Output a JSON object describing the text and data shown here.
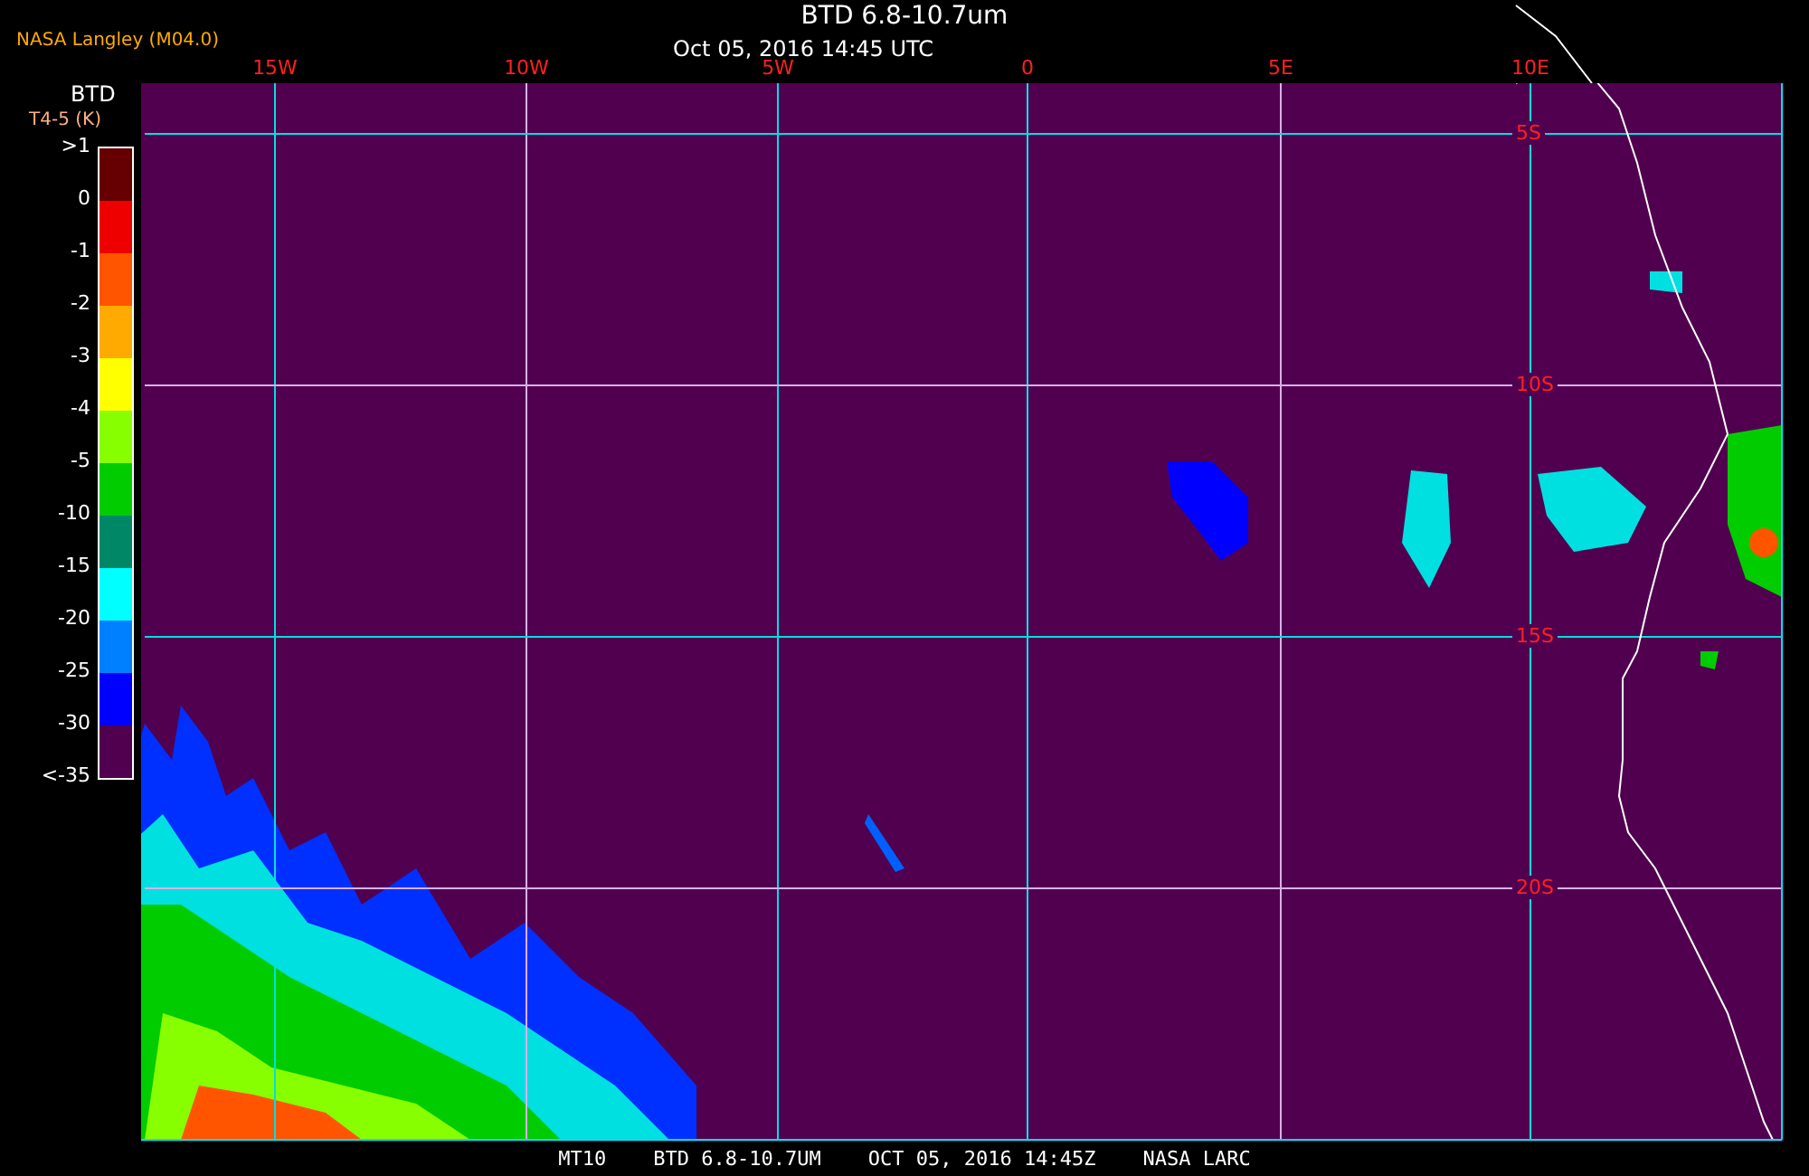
{
  "producer": "NASA Langley (M04.0)",
  "title": "BTD 6.8-10.7um",
  "timestamp": "Oct 05, 2016 14:45 UTC",
  "legend": {
    "title": "BTD",
    "units": "T4-5 (K)",
    "ticks": [
      ">1",
      "0",
      "-1",
      "-2",
      "-3",
      "-4",
      "-5",
      "-10",
      "-15",
      "-20",
      "-25",
      "-30",
      "<-35"
    ],
    "bins": [
      {
        "color": "#660000"
      },
      {
        "color": "#ee0000"
      },
      {
        "color": "#ff5500"
      },
      {
        "color": "#ffaa00"
      },
      {
        "color": "#ffff00"
      },
      {
        "color": "#88ff00"
      },
      {
        "color": "#00cc00"
      },
      {
        "color": "#008866"
      },
      {
        "color": "#00ffff"
      },
      {
        "color": "#0080ff"
      },
      {
        "color": "#0000ff"
      },
      {
        "color": "#510050"
      }
    ]
  },
  "longitude_labels": [
    "15W",
    "10W",
    "5W",
    "0",
    "5E",
    "10E"
  ],
  "latitude_labels": [
    "5S",
    "10S",
    "15S",
    "20S"
  ],
  "footer": [
    "MT10",
    "BTD 6.8-10.7UM",
    "OCT 05, 2016 14:45Z",
    "NASA LARC"
  ]
}
